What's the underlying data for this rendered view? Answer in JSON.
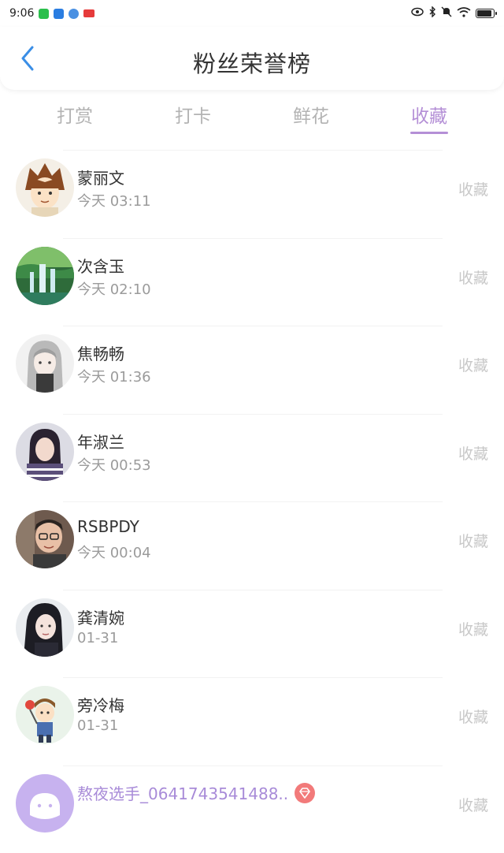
{
  "status_bar": {
    "time": "9:06",
    "left_icons": [
      "wechat-icon",
      "app-icon",
      "browser-icon",
      "notification-badge-icon"
    ],
    "right_icons": [
      "eye-icon",
      "bluetooth-icon",
      "mute-icon",
      "wifi-icon",
      "battery-icon"
    ]
  },
  "header": {
    "title": "粉丝荣誉榜",
    "back_icon": "chevron-left-icon"
  },
  "tabs": [
    {
      "label": "打赏",
      "active": false
    },
    {
      "label": "打卡",
      "active": false
    },
    {
      "label": "鲜花",
      "active": false
    },
    {
      "label": "收藏",
      "active": true
    }
  ],
  "colors": {
    "accent": "#b48fd6",
    "back_arrow": "#3a8ee6",
    "inactive_tab": "#b3b3b3",
    "action_text": "#c8c8c8",
    "badge": "#f27a7a"
  },
  "fans": [
    {
      "name": "蒙丽文",
      "time": "今天 03:11",
      "action": "收藏",
      "avatar": "anime-boy-avatar"
    },
    {
      "name": "次含玉",
      "time": "今天 02:10",
      "action": "收藏",
      "avatar": "waterfall-avatar"
    },
    {
      "name": "焦畅畅",
      "time": "今天 01:36",
      "action": "收藏",
      "avatar": "anime-girl-avatar"
    },
    {
      "name": "年淑兰",
      "time": "今天 00:53",
      "action": "收藏",
      "avatar": "girl-photo-avatar"
    },
    {
      "name": "RSBPDY",
      "time": "今天 00:04",
      "action": "收藏",
      "avatar": "man-glasses-avatar"
    },
    {
      "name": "龚清婉",
      "time": "01-31",
      "action": "收藏",
      "avatar": "woman-photo-avatar"
    },
    {
      "name": "旁冷梅",
      "time": "01-31",
      "action": "收藏",
      "avatar": "cartoon-boy-avatar"
    },
    {
      "name": "熬夜选手_0641743541488..",
      "time": "",
      "action": "收藏",
      "avatar": "default-purple-avatar",
      "badge": "diamond-icon"
    }
  ]
}
